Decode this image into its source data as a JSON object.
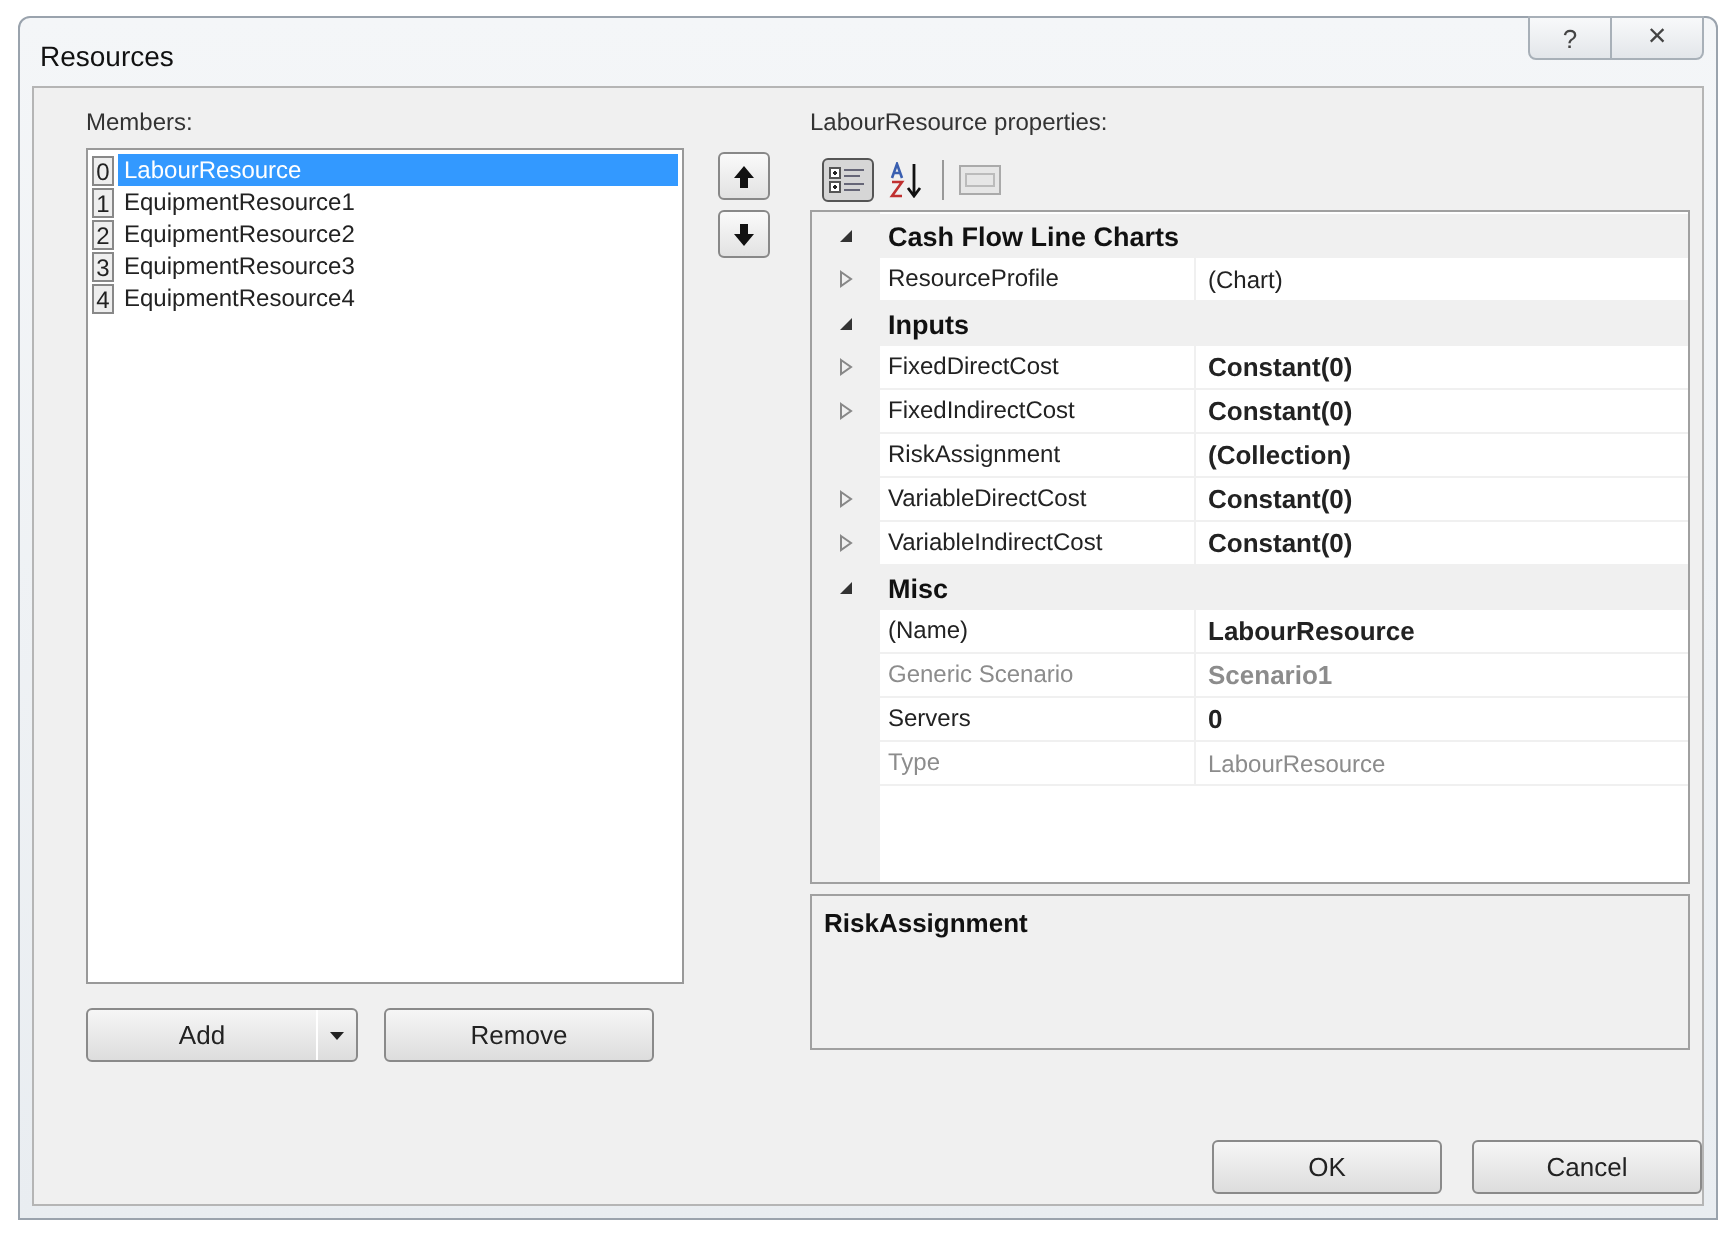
{
  "window": {
    "title": "Resources",
    "help_button": "?",
    "close_button": "×"
  },
  "members": {
    "label": "Members:",
    "items": [
      {
        "index": "0",
        "name": "LabourResource",
        "selected": true
      },
      {
        "index": "1",
        "name": "EquipmentResource1",
        "selected": false
      },
      {
        "index": "2",
        "name": "EquipmentResource2",
        "selected": false
      },
      {
        "index": "3",
        "name": "EquipmentResource3",
        "selected": false
      },
      {
        "index": "4",
        "name": "EquipmentResource4",
        "selected": false
      }
    ]
  },
  "move_buttons": [
    {
      "kind": "up"
    },
    {
      "kind": "down"
    }
  ],
  "properties": {
    "label": "LabourResource properties:",
    "categorized_selected": true,
    "categories": [
      {
        "name": "Cash Flow Line Charts",
        "expanded": true,
        "rows": [
          {
            "name": "ResourceProfile",
            "value": "(Chart)",
            "expandable": true,
            "modified": false,
            "disabled": false
          }
        ]
      },
      {
        "name": "Inputs",
        "expanded": true,
        "rows": [
          {
            "name": "FixedDirectCost",
            "value": "Constant(0)",
            "expandable": true,
            "modified": true,
            "disabled": false
          },
          {
            "name": "FixedIndirectCost",
            "value": "Constant(0)",
            "expandable": true,
            "modified": true,
            "disabled": false
          },
          {
            "name": "RiskAssignment",
            "value": "(Collection)",
            "expandable": false,
            "modified": true,
            "disabled": false
          },
          {
            "name": "VariableDirectCost",
            "value": "Constant(0)",
            "expandable": true,
            "modified": true,
            "disabled": false
          },
          {
            "name": "VariableIndirectCost",
            "value": "Constant(0)",
            "expandable": true,
            "modified": true,
            "disabled": false
          }
        ]
      },
      {
        "name": "Misc",
        "expanded": true,
        "rows": [
          {
            "name": "(Name)",
            "value": "LabourResource",
            "expandable": false,
            "modified": true,
            "disabled": false
          },
          {
            "name": "Generic Scenario",
            "value": "Scenario1",
            "expandable": false,
            "modified": true,
            "disabled": true
          },
          {
            "name": "Servers",
            "value": "0",
            "expandable": false,
            "modified": true,
            "disabled": false
          },
          {
            "name": "Type",
            "value": "LabourResource",
            "expandable": false,
            "modified": false,
            "disabled": true
          }
        ]
      }
    ],
    "description": "RiskAssignment"
  },
  "list_buttons": {
    "add": "Add",
    "remove": "Remove"
  },
  "dialog_buttons": [
    "OK",
    "Cancel"
  ]
}
